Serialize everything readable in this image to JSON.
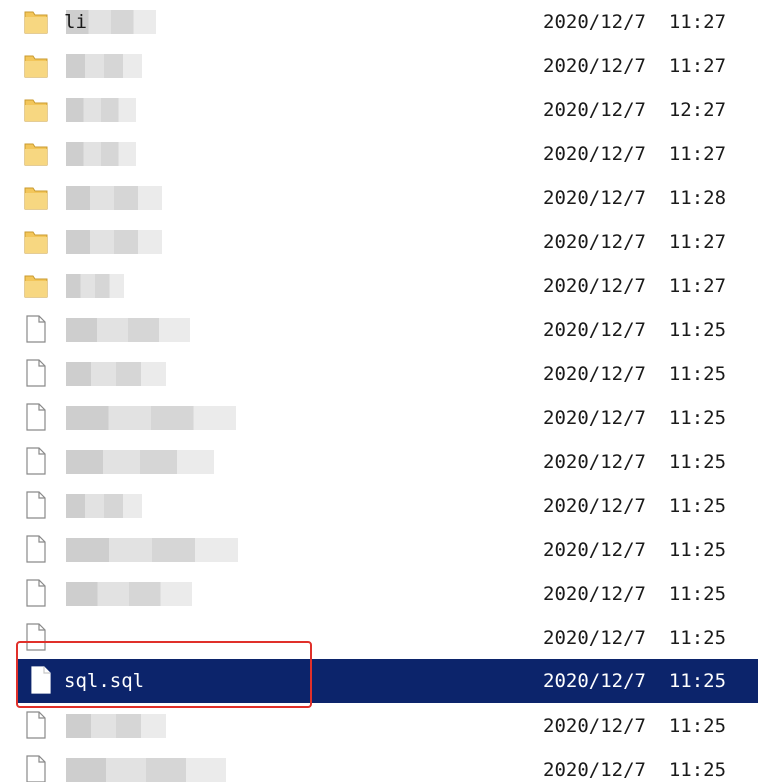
{
  "file_list": {
    "rows": [
      {
        "icon": "folder-icon",
        "name": "li",
        "date": "2020/12/7  11:27",
        "selected": false
      },
      {
        "icon": "folder-icon",
        "name": "",
        "date": "2020/12/7  11:27",
        "selected": false
      },
      {
        "icon": "folder-icon",
        "name": "",
        "date": "2020/12/7  12:27",
        "selected": false
      },
      {
        "icon": "folder-icon",
        "name": "",
        "date": "2020/12/7  11:27",
        "selected": false
      },
      {
        "icon": "folder-icon",
        "name": "",
        "date": "2020/12/7  11:28",
        "selected": false
      },
      {
        "icon": "folder-icon",
        "name": "",
        "date": "2020/12/7  11:27",
        "selected": false
      },
      {
        "icon": "folder-icon",
        "name": "",
        "date": "2020/12/7  11:27",
        "selected": false
      },
      {
        "icon": "file-icon",
        "name": "",
        "date": "2020/12/7  11:25",
        "selected": false
      },
      {
        "icon": "file-icon",
        "name": "",
        "date": "2020/12/7  11:25",
        "selected": false
      },
      {
        "icon": "file-icon",
        "name": "",
        "date": "2020/12/7  11:25",
        "selected": false
      },
      {
        "icon": "file-icon",
        "name": "",
        "date": "2020/12/7  11:25",
        "selected": false
      },
      {
        "icon": "file-icon",
        "name": "",
        "date": "2020/12/7  11:25",
        "selected": false
      },
      {
        "icon": "file-icon",
        "name": "",
        "date": "2020/12/7  11:25",
        "selected": false
      },
      {
        "icon": "file-icon",
        "name": "",
        "date": "2020/12/7  11:25",
        "selected": false
      },
      {
        "icon": "file-icon",
        "name": "",
        "date": "2020/12/7  11:25",
        "selected": false
      },
      {
        "icon": "file-icon",
        "name": "sql.sql",
        "date": "2020/12/7  11:25",
        "selected": true
      },
      {
        "icon": "file-icon",
        "name": "",
        "date": "2020/12/7  11:25",
        "selected": false
      },
      {
        "icon": "file-icon",
        "name": "",
        "date": "2020/12/7  11:25",
        "selected": false
      }
    ]
  },
  "colors": {
    "selection": "#0c246b",
    "highlight_border": "#e0302a",
    "folder": "#f3c65a"
  }
}
